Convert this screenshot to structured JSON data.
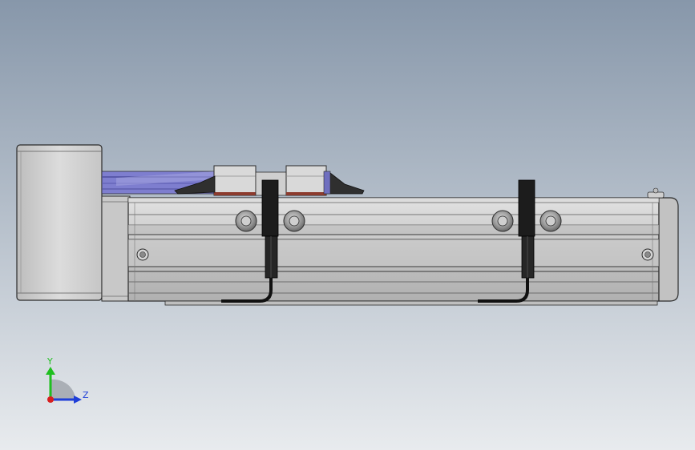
{
  "viewport": {
    "background_top": "#8797aa",
    "background_bottom": "#e8ebee"
  },
  "model": {
    "name": "",
    "colors": {
      "aluminum": "#c9c9c9",
      "aluminum_dark": "#9a9a9a",
      "edge": "#2b2b2b",
      "motor_housing": "#cfcfcf",
      "bellows_blue": "#7e7ecf",
      "bellows_blue_dark": "#4d4d9e",
      "carriage_block": "#d9d9d9",
      "clamp_dark": "#2f2f2f",
      "sensor_black": "#1c1c1c",
      "red_strip": "#8c3b2e"
    }
  },
  "triad": {
    "y_label": "Y",
    "z_label": "Z",
    "y_color": "#1fbf1f",
    "z_color": "#1f3fd8",
    "x_color": "#d81f1f"
  }
}
